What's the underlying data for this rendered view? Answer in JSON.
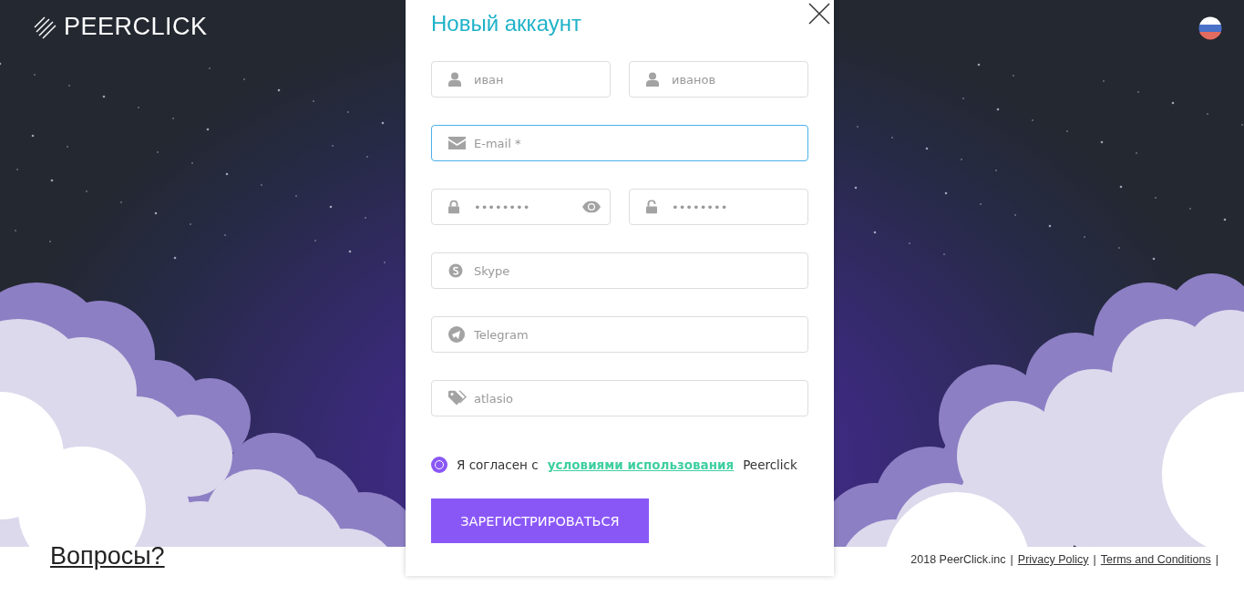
{
  "header": {
    "logo": "PEERCLICK"
  },
  "modal": {
    "title": "Новый аккаунт",
    "rows": [
      [
        {
          "placeholder": "иван",
          "focused": false,
          "reveal": false
        },
        {
          "placeholder": "иванов",
          "focused": false,
          "reveal": false
        }
      ],
      [
        {
          "placeholder": "E-mail *",
          "focused": true,
          "reveal": false
        }
      ],
      [
        {
          "placeholder": "••••••••",
          "focused": false,
          "reveal": true
        },
        {
          "placeholder": "••••••••",
          "focused": false,
          "reveal": false
        }
      ],
      [
        {
          "placeholder": "Skype",
          "focused": false,
          "reveal": false
        }
      ],
      [
        {
          "placeholder": "Telegram",
          "focused": false,
          "reveal": false
        }
      ],
      [
        {
          "placeholder": "atlasio",
          "focused": false,
          "reveal": false
        }
      ]
    ],
    "agree": {
      "checked": true,
      "prefix": "Я согласен с",
      "link": "условиями использования",
      "suffix": "Peerclick"
    },
    "submit": "ЗАРЕГИСТРИРОВАТЬСЯ"
  },
  "questions_link": "Вопросы?",
  "footer": [
    {
      "kind": "text",
      "text": "2018 PeerClick.inc"
    },
    {
      "kind": "sep",
      "text": "|"
    },
    {
      "kind": "link",
      "text": "Privacy Policy"
    },
    {
      "kind": "sep",
      "text": "|"
    },
    {
      "kind": "link",
      "text": "Terms and Conditions"
    },
    {
      "kind": "sep",
      "text": "|"
    }
  ]
}
